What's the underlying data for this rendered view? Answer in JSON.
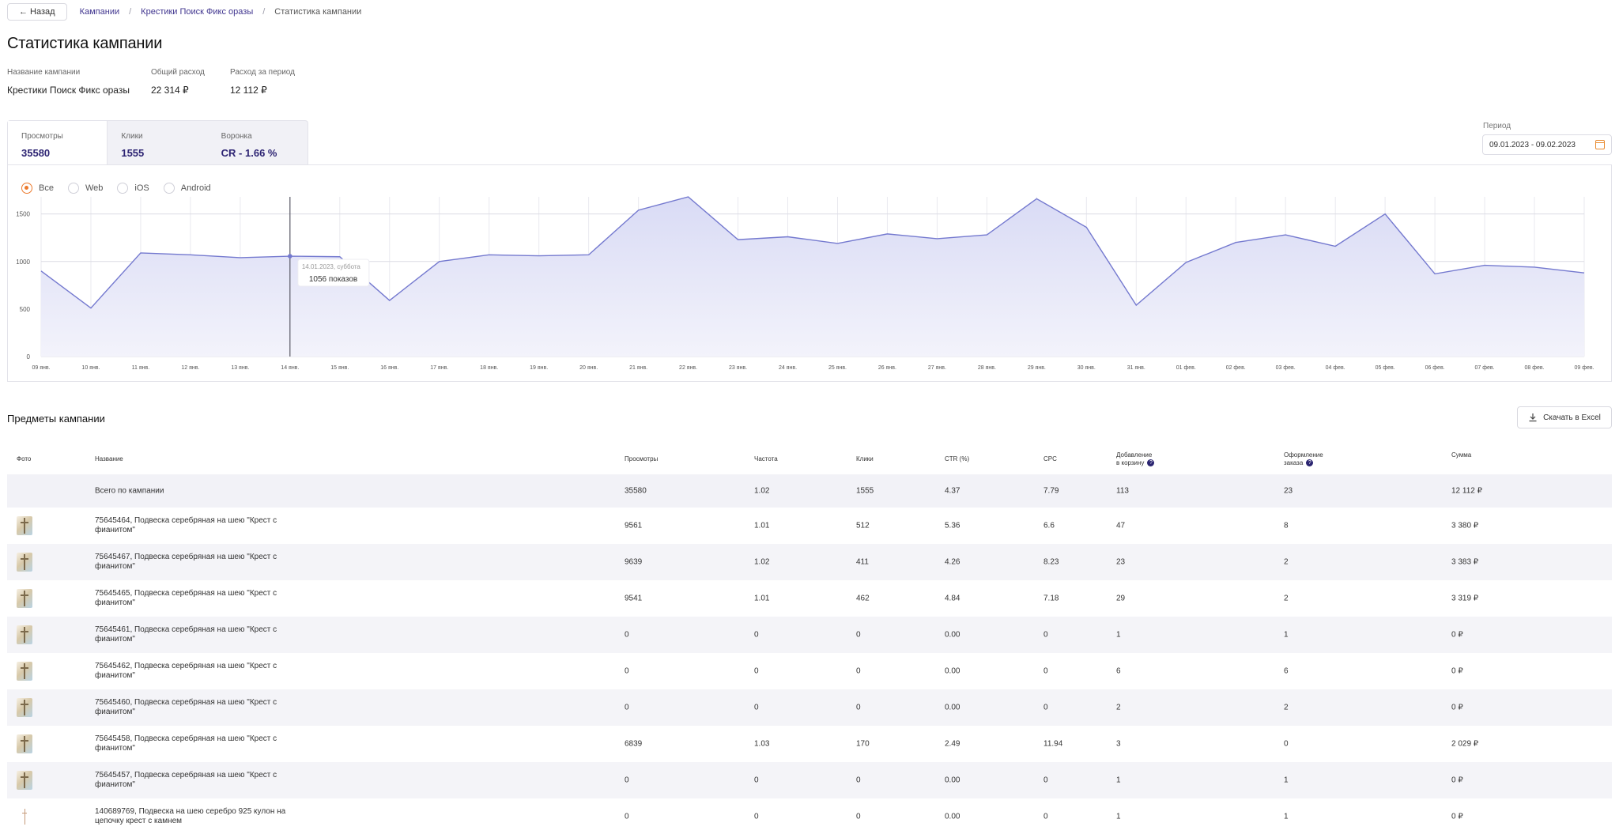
{
  "nav": {
    "back_label": "← Назад",
    "breadcrumbs": [
      "Кампании",
      "Крестики Поиск Фикс оразы",
      "Статистика кампании"
    ]
  },
  "page_title": "Статистика кампании",
  "meta": {
    "campaign_label": "Название кампании",
    "campaign_value": "Крестики Поиск Фикс оразы",
    "total_spend_label": "Общий расход",
    "total_spend_value": "22 314 ₽",
    "period_spend_label": "Расход за период",
    "period_spend_value": "12 112 ₽"
  },
  "tabs": [
    {
      "label": "Просмотры",
      "value": "35580"
    },
    {
      "label": "Клики",
      "value": "1555"
    },
    {
      "label": "Воронка",
      "value": "CR - 1.66 %"
    }
  ],
  "period": {
    "label": "Период",
    "value": "09.01.2023 - 09.02.2023"
  },
  "platforms": [
    "Все",
    "Web",
    "iOS",
    "Android"
  ],
  "tooltip": {
    "date": "14.01.2023, суббота",
    "value": "1056 показов"
  },
  "chart_data": {
    "type": "area",
    "x": [
      "09 янв.",
      "10 янв.",
      "11 янв.",
      "12 янв.",
      "13 янв.",
      "14 янв.",
      "15 янв.",
      "16 янв.",
      "17 янв.",
      "18 янв.",
      "19 янв.",
      "20 янв.",
      "21 янв.",
      "22 янв.",
      "23 янв.",
      "24 янв.",
      "25 янв.",
      "26 янв.",
      "27 янв.",
      "28 янв.",
      "29 янв.",
      "30 янв.",
      "31 янв.",
      "01 фев.",
      "02 фев.",
      "03 фев.",
      "04 фев.",
      "05 фев.",
      "06 фев.",
      "07 фев.",
      "08 фев.",
      "09 фев."
    ],
    "values": [
      900,
      510,
      1090,
      1070,
      1040,
      1056,
      1050,
      590,
      1000,
      1070,
      1060,
      1070,
      1540,
      1680,
      1230,
      1260,
      1190,
      1290,
      1240,
      1280,
      1660,
      1360,
      540,
      990,
      1200,
      1280,
      1160,
      1500,
      870,
      960,
      940,
      880
    ],
    "yticks": [
      0,
      500,
      1000,
      1500
    ],
    "ylim": [
      0,
      1680
    ],
    "highlight_index": 5,
    "colors": {
      "line": "#7479cf",
      "fill": "#e6e7f8",
      "grid": "#e9e9ef"
    }
  },
  "items_title": "Предметы кампании",
  "excel_label": "Скачать в Excel",
  "table": {
    "headers": {
      "photo": "Фото",
      "name": "Название",
      "views": "Просмотры",
      "freq": "Частота",
      "clicks": "Клики",
      "ctr": "CTR (%)",
      "cpc": "CPC",
      "cart_l1": "Добавление",
      "cart_l2": "в корзину",
      "order_l1": "Оформление",
      "order_l2": "заказа",
      "sum": "Сумма"
    },
    "total": {
      "name": "Всего по кампании",
      "views": "35580",
      "freq": "1.02",
      "clicks": "1555",
      "ctr": "4.37",
      "cpc": "7.79",
      "cart": "113",
      "order": "23",
      "sum": "12 112 ₽"
    },
    "rows": [
      {
        "l1": "75645464, Подвеска серебряная на шею \"Крест с",
        "l2": "фианитом\"",
        "views": "9561",
        "freq": "1.01",
        "clicks": "512",
        "ctr": "5.36",
        "cpc": "6.6",
        "cart": "47",
        "order": "8",
        "sum": "3 380 ₽"
      },
      {
        "l1": "75645467, Подвеска серебряная на шею \"Крест с",
        "l2": "фианитом\"",
        "views": "9639",
        "freq": "1.02",
        "clicks": "411",
        "ctr": "4.26",
        "cpc": "8.23",
        "cart": "23",
        "order": "2",
        "sum": "3 383 ₽"
      },
      {
        "l1": "75645465, Подвеска серебряная на шею \"Крест с",
        "l2": "фианитом\"",
        "views": "9541",
        "freq": "1.01",
        "clicks": "462",
        "ctr": "4.84",
        "cpc": "7.18",
        "cart": "29",
        "order": "2",
        "sum": "3 319 ₽"
      },
      {
        "l1": "75645461, Подвеска серебряная на шею \"Крест с",
        "l2": "фианитом\"",
        "views": "0",
        "freq": "0",
        "clicks": "0",
        "ctr": "0.00",
        "cpc": "0",
        "cart": "1",
        "order": "1",
        "sum": "0 ₽"
      },
      {
        "l1": "75645462, Подвеска серебряная на шею \"Крест с",
        "l2": "фианитом\"",
        "views": "0",
        "freq": "0",
        "clicks": "0",
        "ctr": "0.00",
        "cpc": "0",
        "cart": "6",
        "order": "6",
        "sum": "0 ₽"
      },
      {
        "l1": "75645460, Подвеска серебряная на шею \"Крест с",
        "l2": "фианитом\"",
        "views": "0",
        "freq": "0",
        "clicks": "0",
        "ctr": "0.00",
        "cpc": "0",
        "cart": "2",
        "order": "2",
        "sum": "0 ₽"
      },
      {
        "l1": "75645458, Подвеска серебряная на шею \"Крест с",
        "l2": "фианитом\"",
        "views": "6839",
        "freq": "1.03",
        "clicks": "170",
        "ctr": "2.49",
        "cpc": "11.94",
        "cart": "3",
        "order": "0",
        "sum": "2 029 ₽"
      },
      {
        "l1": "75645457, Подвеска серебряная на шею \"Крест с",
        "l2": "фианитом\"",
        "views": "0",
        "freq": "0",
        "clicks": "0",
        "ctr": "0.00",
        "cpc": "0",
        "cart": "1",
        "order": "1",
        "sum": "0 ₽"
      },
      {
        "l1": "140689769, Подвеска на шею серебро 925 кулон на",
        "l2": "цепочку крест с камнем",
        "views": "0",
        "freq": "0",
        "clicks": "0",
        "ctr": "0.00",
        "cpc": "0",
        "cart": "1",
        "order": "1",
        "sum": "0 ₽"
      }
    ]
  }
}
